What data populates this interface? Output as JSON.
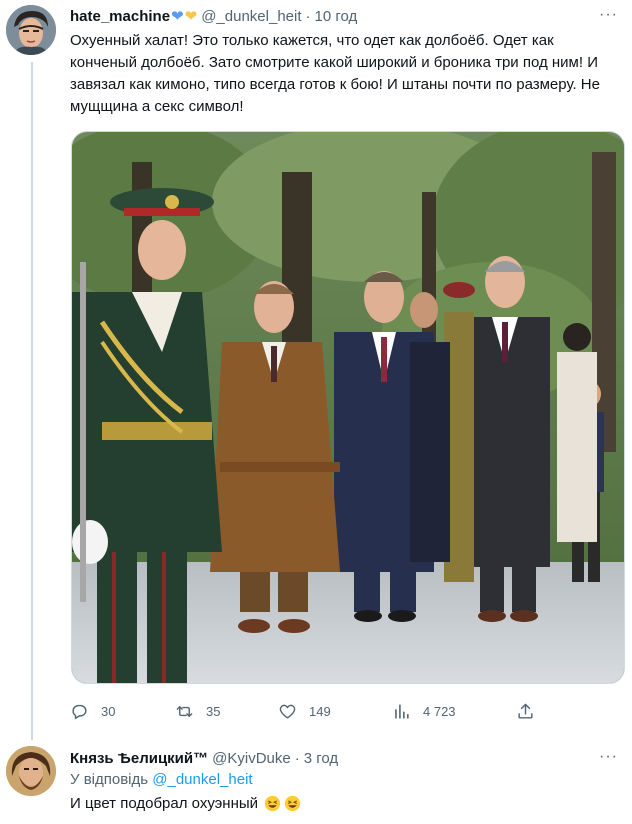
{
  "tweet": {
    "display_name": "hate_machine",
    "handle": "@_dunkel_heit",
    "separator": "·",
    "time": "10 год",
    "text": "Охуенный халат! Это только кажется, что одет как долбоёб. Одет как конченый долбоёб. Зато смотрите какой широкий и броника три под ним! И завязал как кимоно, типо всегда готов к бою! И штаны почти по размеру. Не мущщина а секс символ!",
    "actions": {
      "replies": "30",
      "retweets": "35",
      "likes": "149",
      "views": "4 723"
    },
    "icons": [
      "blue-heart",
      "yellow-heart",
      "more-icon",
      "reply-icon",
      "retweet-icon",
      "like-icon",
      "views-icon",
      "share-icon"
    ]
  },
  "reply": {
    "display_name": "Князь Ѣелицкий™",
    "handle": "@KyivDuke",
    "separator": "·",
    "time": "3 год",
    "replying_prefix": "У відповідь",
    "replying_mention": "@_dunkel_heit",
    "text": "И цвет подобрал охуэнный",
    "emoji": [
      "grinning-squinting-face",
      "grinning-squinting-face"
    ]
  },
  "colors": {
    "text": "#0f1419",
    "secondary": "#536471",
    "link": "#1d9bf0",
    "thread_line": "#cfd9de"
  }
}
